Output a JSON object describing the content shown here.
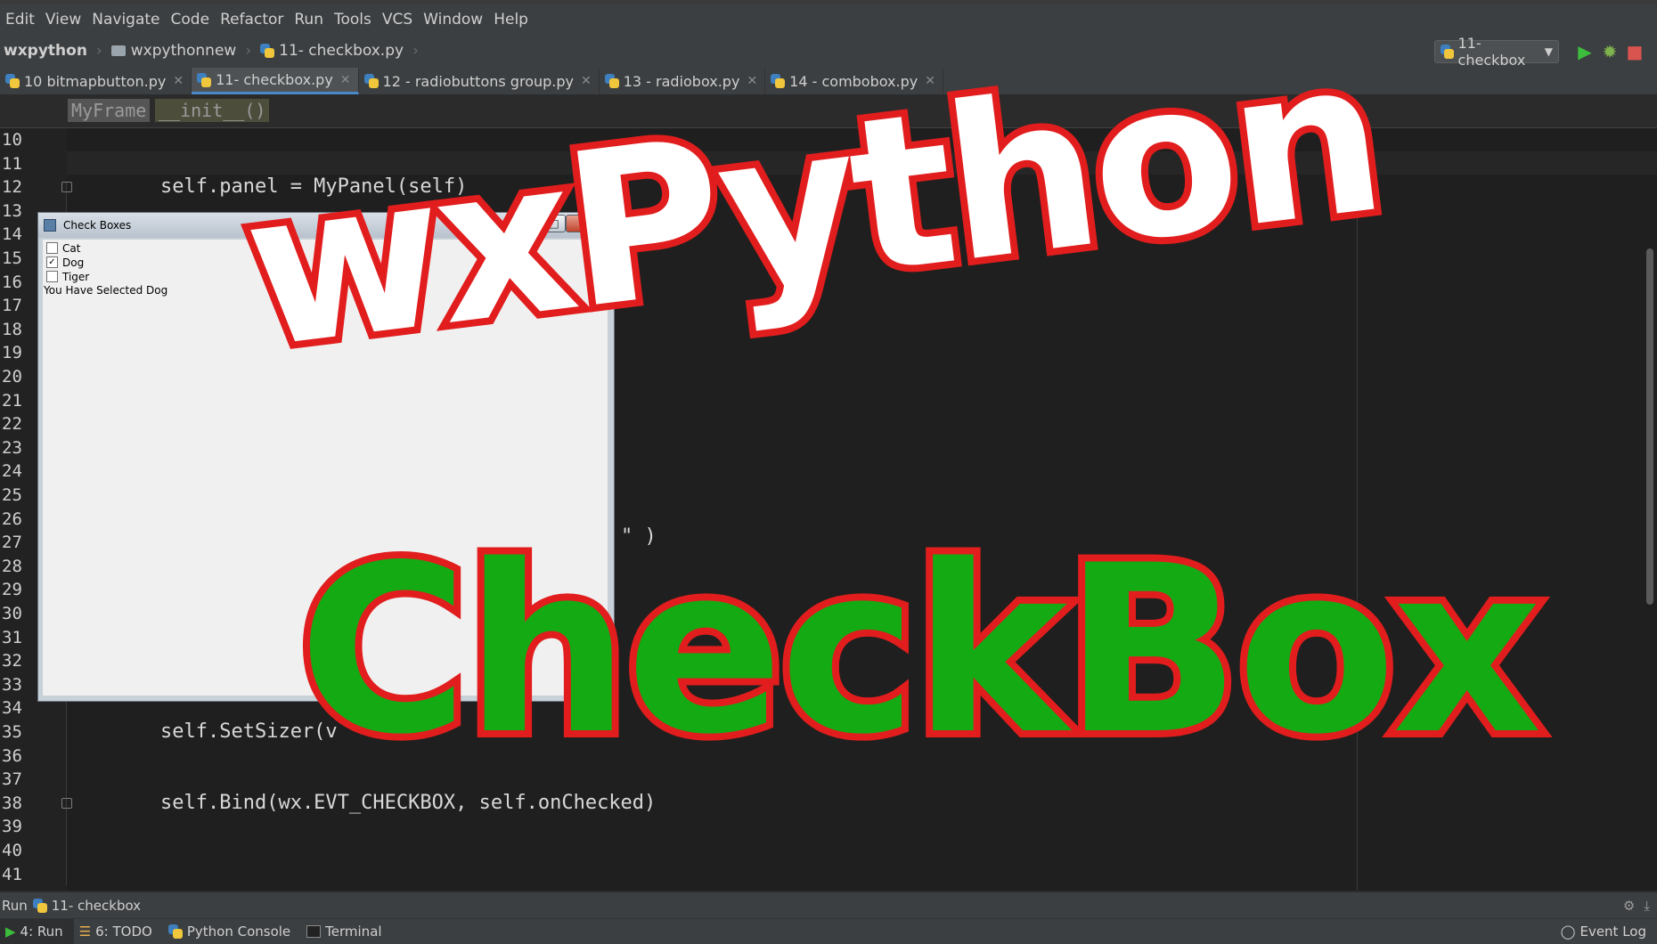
{
  "menu": [
    "Edit",
    "View",
    "Navigate",
    "Code",
    "Refactor",
    "Run",
    "Tools",
    "VCS",
    "Window",
    "Help"
  ],
  "nav": {
    "project": "wxpython",
    "folder": "wxpythonnew",
    "file": "11- checkbox.py"
  },
  "run_config": {
    "label": "11- checkbox"
  },
  "tabs": [
    {
      "label": "10 bitmapbutton.py"
    },
    {
      "label": "11- checkbox.py"
    },
    {
      "label": "12 - radiobuttons group.py"
    },
    {
      "label": "13 - radiobox.py"
    },
    {
      "label": "14 - combobox.py"
    }
  ],
  "breadcrumb": {
    "class": "MyFrame",
    "method": "__init__()"
  },
  "lines": [
    {
      "n": "10",
      "code": ""
    },
    {
      "n": "11",
      "code": ""
    },
    {
      "n": "12",
      "code": "self.panel = MyPanel(self)"
    },
    {
      "n": "13",
      "code": ""
    },
    {
      "n": "14",
      "code": ""
    },
    {
      "n": "15",
      "code": ""
    },
    {
      "n": "16",
      "code": ""
    },
    {
      "n": "17",
      "code": ""
    },
    {
      "n": "18",
      "code": ""
    },
    {
      "n": "19",
      "code": ""
    },
    {
      "n": "20",
      "code": ""
    },
    {
      "n": "21",
      "code": ""
    },
    {
      "n": "22",
      "code": ""
    },
    {
      "n": "23",
      "code": ""
    },
    {
      "n": "24",
      "code": ""
    },
    {
      "n": "25",
      "code": ""
    },
    {
      "n": "26",
      "code": ""
    },
    {
      "n": "27",
      "code": ""
    },
    {
      "n": "28",
      "code": ""
    },
    {
      "n": "29",
      "code": ""
    },
    {
      "n": "30",
      "code": ""
    },
    {
      "n": "31",
      "code": ""
    },
    {
      "n": "32",
      "code": ""
    },
    {
      "n": "33",
      "code": ""
    },
    {
      "n": "34",
      "code": ""
    },
    {
      "n": "35",
      "code": "self.SetSizer(v"
    },
    {
      "n": "36",
      "code": ""
    },
    {
      "n": "37",
      "code": ""
    },
    {
      "n": "38",
      "code": "self.Bind(wx.EVT_CHECKBOX, self.onChecked)"
    },
    {
      "n": "39",
      "code": ""
    },
    {
      "n": "40",
      "code": ""
    },
    {
      "n": "41",
      "code": ""
    }
  ],
  "partial_code_27": "\" )",
  "wxwindow": {
    "title": "Check Boxes",
    "checkboxes": [
      {
        "label": "Cat",
        "checked": false
      },
      {
        "label": "Dog",
        "checked": true
      },
      {
        "label": "Tiger",
        "checked": false
      }
    ],
    "status": "You Have Selected Dog"
  },
  "overlay": {
    "line1": "wxPython",
    "line2": "CheckBox"
  },
  "runbar": {
    "label": "Run",
    "config": "11- checkbox"
  },
  "statusbar": {
    "run": "4: Run",
    "todo": "6: TODO",
    "console": "Python Console",
    "terminal": "Terminal",
    "eventlog": "Event Log"
  },
  "colors": {
    "overlay_white": "#ffffff",
    "overlay_green": "#14aa14",
    "overlay_outline": "#e11d1d",
    "editor_bg": "#1f1f1f",
    "ide_chrome": "#3c3f41"
  }
}
